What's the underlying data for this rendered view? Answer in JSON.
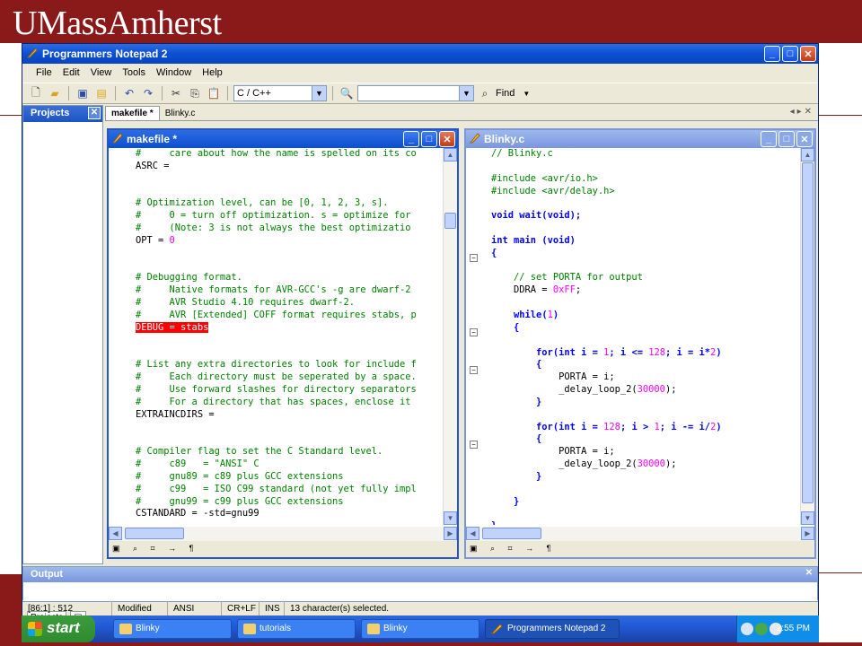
{
  "banner": {
    "title": "UMassAmherst"
  },
  "app": {
    "title": "Programmers Notepad 2",
    "window_buttons": [
      "_",
      "□",
      "✕"
    ],
    "menu": [
      "File",
      "Edit",
      "View",
      "Tools",
      "Window",
      "Help"
    ],
    "language_combo": "C / C++",
    "search_combo": "",
    "find_label": "Find"
  },
  "sidebar": {
    "title": "Projects",
    "tabs": [
      "Projects"
    ]
  },
  "doc_tabs": [
    "makefile *",
    "Blinky.c"
  ],
  "makefile": {
    "title": "makefile *",
    "lines": [
      [
        {
          "t": "#     care about how the name is spelled on its co",
          "c": "cm"
        }
      ],
      [
        {
          "t": "ASRC ="
        }
      ],
      [
        {
          "t": ""
        }
      ],
      [
        {
          "t": ""
        }
      ],
      [
        {
          "t": "# Optimization level, can be [0, 1, 2, 3, s].",
          "c": "cm"
        }
      ],
      [
        {
          "t": "#     0 = turn off optimization. s = optimize for",
          "c": "cm"
        }
      ],
      [
        {
          "t": "#     (Note: 3 is not always the best optimizatio",
          "c": "cm"
        }
      ],
      [
        {
          "t": "OPT = "
        },
        {
          "t": "0",
          "c": "num"
        }
      ],
      [
        {
          "t": ""
        }
      ],
      [
        {
          "t": ""
        }
      ],
      [
        {
          "t": "# Debugging format.",
          "c": "cm"
        }
      ],
      [
        {
          "t": "#     Native formats for AVR-GCC's -g are dwarf-2",
          "c": "cm"
        }
      ],
      [
        {
          "t": "#     AVR Studio 4.10 requires dwarf-2.",
          "c": "cm"
        }
      ],
      [
        {
          "t": "#     AVR [Extended] COFF format requires stabs, p",
          "c": "cm"
        }
      ],
      [
        {
          "t": "DEBUG = stabs",
          "c": "hl"
        }
      ],
      [
        {
          "t": ""
        }
      ],
      [
        {
          "t": ""
        }
      ],
      [
        {
          "t": "# List any extra directories to look for include f",
          "c": "cm"
        }
      ],
      [
        {
          "t": "#     Each directory must be seperated by a space.",
          "c": "cm"
        }
      ],
      [
        {
          "t": "#     Use forward slashes for directory separators",
          "c": "cm"
        }
      ],
      [
        {
          "t": "#     For a directory that has spaces, enclose it",
          "c": "cm"
        }
      ],
      [
        {
          "t": "EXTRAINCDIRS ="
        }
      ],
      [
        {
          "t": ""
        }
      ],
      [
        {
          "t": ""
        }
      ],
      [
        {
          "t": "# Compiler flag to set the C Standard level.",
          "c": "cm"
        }
      ],
      [
        {
          "t": "#     c89   = \"ANSI\" C",
          "c": "cm"
        }
      ],
      [
        {
          "t": "#     gnu89 = c89 plus GCC extensions",
          "c": "cm"
        }
      ],
      [
        {
          "t": "#     c99   = ISO C99 standard (not yet fully impl",
          "c": "cm"
        }
      ],
      [
        {
          "t": "#     gnu99 = c99 plus GCC extensions",
          "c": "cm"
        }
      ],
      [
        {
          "t": "CSTANDARD = -std=gnu99"
        }
      ]
    ]
  },
  "blinky": {
    "title": "Blinky.c",
    "lines": [
      [
        {
          "t": "// Blinky.c",
          "c": "cm"
        }
      ],
      [
        {
          "t": ""
        }
      ],
      [
        {
          "t": "#include ",
          "c": "cm"
        },
        {
          "t": "<avr/io.h>",
          "c": "cm"
        }
      ],
      [
        {
          "t": "#include ",
          "c": "cm"
        },
        {
          "t": "<avr/delay.h>",
          "c": "cm"
        }
      ],
      [
        {
          "t": ""
        }
      ],
      [
        {
          "t": "void",
          "c": "kw"
        },
        {
          "t": " wait(",
          "c": "kw"
        },
        {
          "t": "void",
          "c": "kw"
        },
        {
          "t": ");",
          "c": "kw"
        }
      ],
      [
        {
          "t": ""
        }
      ],
      [
        {
          "t": "int",
          "c": "kw"
        },
        {
          "t": " main (",
          "c": "kw"
        },
        {
          "t": "void",
          "c": "kw"
        },
        {
          "t": ")",
          "c": "kw"
        }
      ],
      [
        {
          "t": "{",
          "c": "kw"
        }
      ],
      [
        {
          "t": ""
        }
      ],
      [
        {
          "t": "    // set PORTA for output",
          "c": "cm"
        }
      ],
      [
        {
          "t": "    DDRA = "
        },
        {
          "t": "0xFF",
          "c": "num"
        },
        {
          "t": ";"
        }
      ],
      [
        {
          "t": ""
        }
      ],
      [
        {
          "t": "    while",
          "c": "kw"
        },
        {
          "t": "(",
          "c": "kw"
        },
        {
          "t": "1",
          "c": "num"
        },
        {
          "t": ")",
          "c": "kw"
        }
      ],
      [
        {
          "t": "    {",
          "c": "kw"
        }
      ],
      [
        {
          "t": ""
        }
      ],
      [
        {
          "t": "        for",
          "c": "kw"
        },
        {
          "t": "(",
          "c": "kw"
        },
        {
          "t": "int",
          "c": "kw"
        },
        {
          "t": " i = ",
          "c": "kw"
        },
        {
          "t": "1",
          "c": "num"
        },
        {
          "t": "; i <= ",
          "c": "kw"
        },
        {
          "t": "128",
          "c": "num"
        },
        {
          "t": "; i = i*",
          "c": "kw"
        },
        {
          "t": "2",
          "c": "num"
        },
        {
          "t": ")",
          "c": "kw"
        }
      ],
      [
        {
          "t": "        {",
          "c": "kw"
        }
      ],
      [
        {
          "t": "            PORTA = i;"
        }
      ],
      [
        {
          "t": "            _delay_loop_2("
        },
        {
          "t": "30000",
          "c": "num"
        },
        {
          "t": ");"
        }
      ],
      [
        {
          "t": "        }",
          "c": "kw"
        }
      ],
      [
        {
          "t": ""
        }
      ],
      [
        {
          "t": "        for",
          "c": "kw"
        },
        {
          "t": "(",
          "c": "kw"
        },
        {
          "t": "int",
          "c": "kw"
        },
        {
          "t": " i = ",
          "c": "kw"
        },
        {
          "t": "128",
          "c": "num"
        },
        {
          "t": "; i > ",
          "c": "kw"
        },
        {
          "t": "1",
          "c": "num"
        },
        {
          "t": "; i -= i/",
          "c": "kw"
        },
        {
          "t": "2",
          "c": "num"
        },
        {
          "t": ")",
          "c": "kw"
        }
      ],
      [
        {
          "t": "        {",
          "c": "kw"
        }
      ],
      [
        {
          "t": "            PORTA = i;"
        }
      ],
      [
        {
          "t": "            _delay_loop_2("
        },
        {
          "t": "30000",
          "c": "num"
        },
        {
          "t": ");"
        }
      ],
      [
        {
          "t": "        }",
          "c": "kw"
        }
      ],
      [
        {
          "t": ""
        }
      ],
      [
        {
          "t": "    }",
          "c": "kw"
        }
      ],
      [
        {
          "t": ""
        }
      ],
      [
        {
          "t": "}",
          "c": "kw"
        }
      ]
    ]
  },
  "output": {
    "title": "Output"
  },
  "status": {
    "position": "[86:1] : 512",
    "modified": "Modified",
    "encoding": "ANSI",
    "line_ending": "CR+LF",
    "mode": "INS",
    "selection": "13 character(s) selected."
  },
  "taskbar": {
    "start": "start",
    "items": [
      "Blinky",
      "tutorials",
      "Blinky",
      "Programmers Notepad 2"
    ],
    "time": "2:55 PM"
  },
  "colors": {
    "banner": "#8a1a1a",
    "title_blue": "#0a4fd4",
    "comment": "#008000",
    "keyword": "#0000ff",
    "number": "#ff00ff",
    "highlight": "#ff0000"
  }
}
